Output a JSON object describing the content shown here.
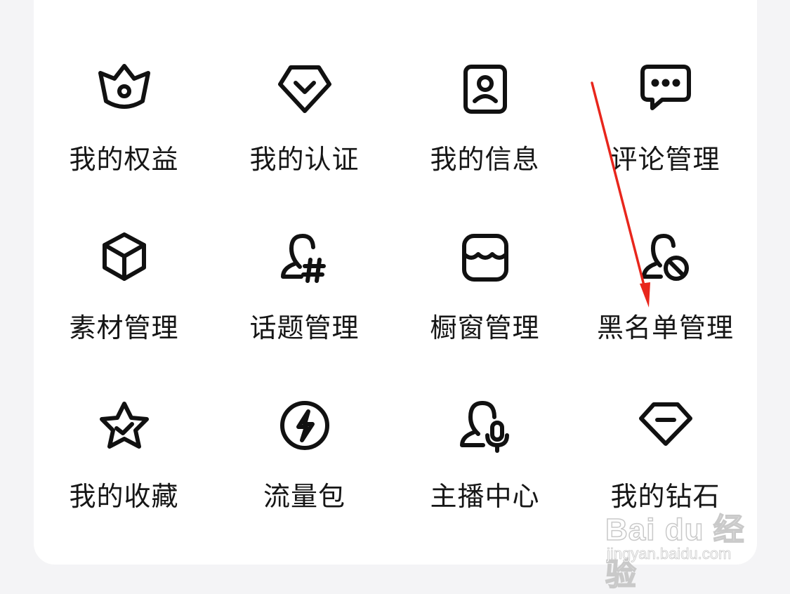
{
  "grid": {
    "items": [
      {
        "label": "我的权益",
        "icon": "crown-icon"
      },
      {
        "label": "我的认证",
        "icon": "verified-badge-icon"
      },
      {
        "label": "我的信息",
        "icon": "profile-card-icon"
      },
      {
        "label": "评论管理",
        "icon": "comment-icon"
      },
      {
        "label": "素材管理",
        "icon": "cube-icon"
      },
      {
        "label": "话题管理",
        "icon": "user-hashtag-icon"
      },
      {
        "label": "橱窗管理",
        "icon": "storefront-icon"
      },
      {
        "label": "黑名单管理",
        "icon": "user-block-icon"
      },
      {
        "label": "我的收藏",
        "icon": "star-check-icon"
      },
      {
        "label": "流量包",
        "icon": "lightning-icon"
      },
      {
        "label": "主播中心",
        "icon": "user-mic-icon"
      },
      {
        "label": "我的钻石",
        "icon": "diamond-icon"
      }
    ]
  },
  "annotation": {
    "arrow_color": "#e8261c",
    "target": "黑名单管理"
  },
  "watermark": {
    "main": "Bai du 经验",
    "sub": "jingyan.baidu.com"
  }
}
